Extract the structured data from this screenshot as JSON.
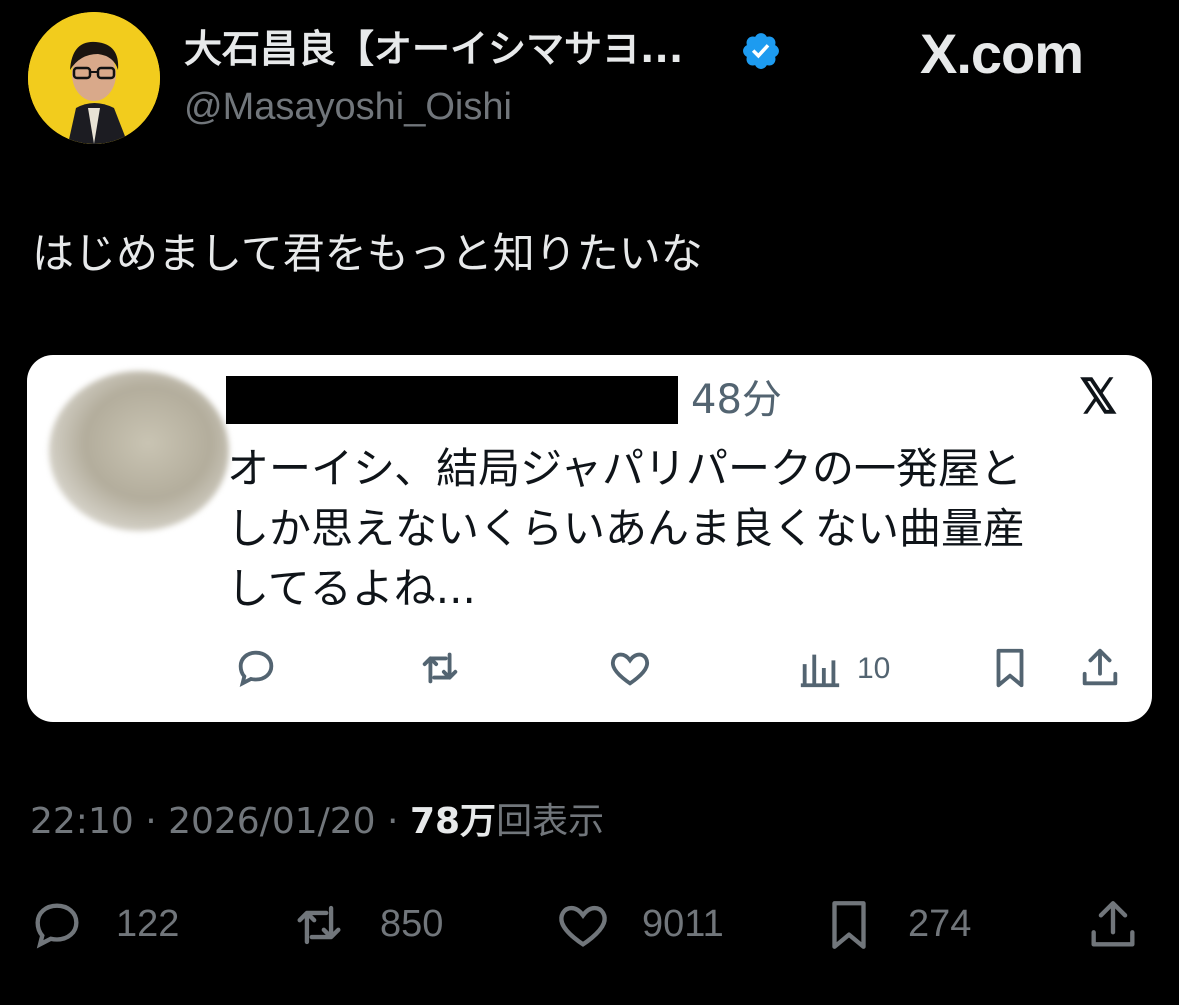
{
  "header": {
    "display_name": "大石昌良【オーイシマサヨ...",
    "handle": "@Masayoshi_Oishi",
    "verified_icon": "verified-badge-icon",
    "brand": "X.com"
  },
  "tweet": {
    "text": "はじめまして君をもっと知りたいな"
  },
  "quoted": {
    "time": "48分",
    "x_logo": "𝕏",
    "body": "オーイシ、結局ジャパリパークの一発屋と\nしか思えないくらいあんま良くない曲量産\nしてるよね...",
    "views": "10",
    "colors": {
      "background": "#ffffff",
      "text": "#0f1419",
      "muted": "#536471"
    }
  },
  "meta": {
    "time": "22:10",
    "sep1": " · ",
    "date": "2026/01/20",
    "sep2": " · ",
    "views_num": "78",
    "views_unit": "万",
    "views_suffix": "回表示"
  },
  "actions": {
    "replies": "122",
    "reposts": "850",
    "likes": "9011",
    "bookmarks": "274"
  },
  "colors": {
    "background": "#000000",
    "text": "#e7e9ea",
    "muted": "#71767b",
    "verified": "#1d9bf0",
    "avatar_bg": "#f2cc1d"
  }
}
